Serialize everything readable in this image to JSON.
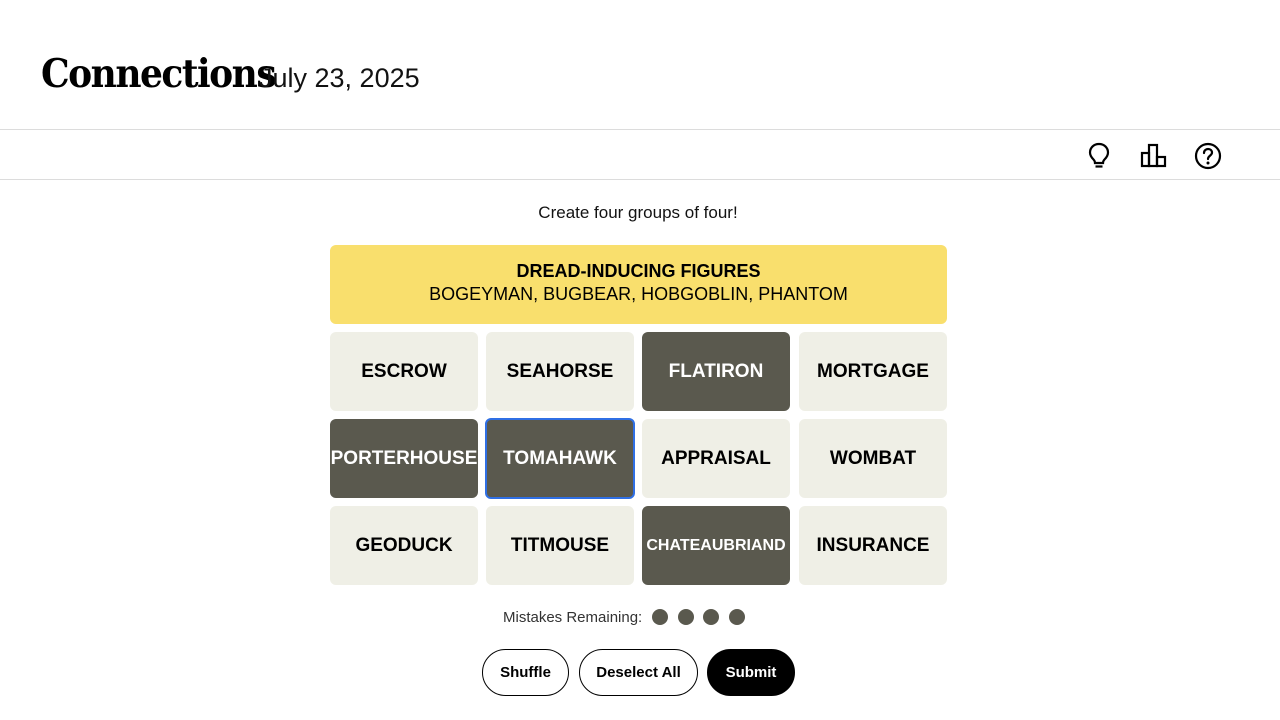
{
  "header": {
    "title": "Connections",
    "date": "July 23, 2025"
  },
  "toolbar": {
    "icons": [
      "lightbulb-icon",
      "leaderboard-icon",
      "help-icon"
    ]
  },
  "instructions": "Create four groups of four!",
  "solved_groups": [
    {
      "title": "DREAD-INDUCING FIGURES",
      "members": "BOGEYMAN, BUGBEAR, HOBGOBLIN, PHANTOM",
      "color": "#f9df6d"
    }
  ],
  "tiles": [
    {
      "word": "ESCROW",
      "selected": false
    },
    {
      "word": "SEAHORSE",
      "selected": false
    },
    {
      "word": "FLATIRON",
      "selected": true
    },
    {
      "word": "MORTGAGE",
      "selected": false
    },
    {
      "word": "PORTERHOUSE",
      "selected": true
    },
    {
      "word": "TOMAHAWK",
      "selected": true,
      "focused": true
    },
    {
      "word": "APPRAISAL",
      "selected": false
    },
    {
      "word": "WOMBAT",
      "selected": false
    },
    {
      "word": "GEODUCK",
      "selected": false
    },
    {
      "word": "TITMOUSE",
      "selected": false
    },
    {
      "word": "CHATEAUBRIAND",
      "selected": true
    },
    {
      "word": "INSURANCE",
      "selected": false
    }
  ],
  "mistakes": {
    "label": "Mistakes Remaining:",
    "remaining": 4
  },
  "buttons": {
    "shuffle": "Shuffle",
    "deselect_all": "Deselect All",
    "submit": "Submit"
  },
  "colors": {
    "yellow_group": "#f9df6d",
    "tile_bg": "#efefe6",
    "tile_selected": "#5a594e",
    "focus_ring": "#2f6fe4"
  }
}
